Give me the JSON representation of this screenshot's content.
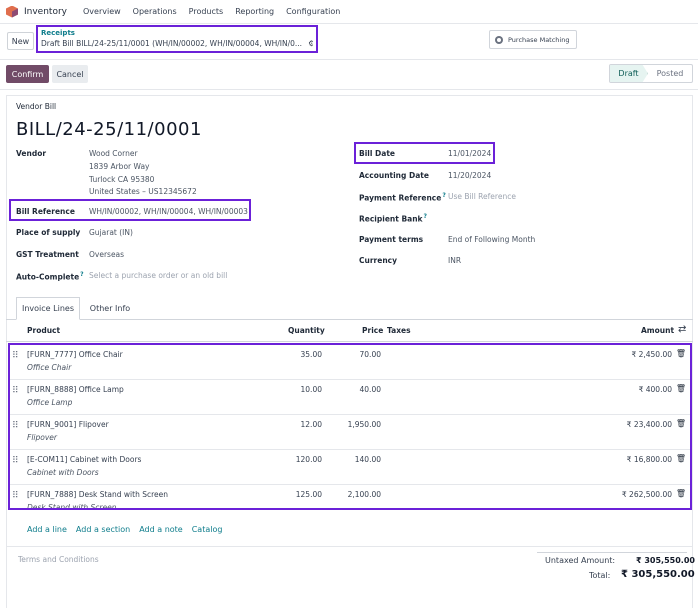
{
  "nav": {
    "app_name": "Inventory",
    "menu": [
      "Overview",
      "Operations",
      "Products",
      "Reporting",
      "Configuration"
    ]
  },
  "control": {
    "new_label": "New",
    "breadcrumb_parent": "Receipts",
    "breadcrumb_current": "Draft Bill BILL/24-25/11/0001 (WH/IN/00002, WH/IN/00004, WH/IN/0...",
    "purchase_matching_label": "Purchase Matching"
  },
  "actions": {
    "confirm_label": "Confirm",
    "cancel_label": "Cancel",
    "status_steps": [
      "Draft",
      "Posted"
    ],
    "active_status": "Draft"
  },
  "form": {
    "doc_type": "Vendor Bill",
    "title": "BILL/24-25/11/0001",
    "vendor_label": "Vendor",
    "vendor_lines": [
      "Wood Corner",
      "1839 Arbor Way",
      "Turlock CA 95380",
      "United States – US12345672"
    ],
    "bill_reference_label": "Bill Reference",
    "bill_reference_value": "WH/IN/00002, WH/IN/00004, WH/IN/00003",
    "place_of_supply_label": "Place of supply",
    "place_of_supply_value": "Gujarat (IN)",
    "gst_treatment_label": "GST Treatment",
    "gst_treatment_value": "Overseas",
    "auto_complete_label": "Auto-Complete",
    "auto_complete_placeholder": "Select a purchase order or an old bill",
    "bill_date_label": "Bill Date",
    "bill_date_value": "11/01/2024",
    "accounting_date_label": "Accounting Date",
    "accounting_date_value": "11/20/2024",
    "payment_reference_label": "Payment Reference",
    "payment_reference_placeholder": "Use Bill Reference",
    "recipient_bank_label": "Recipient Bank",
    "payment_terms_label": "Payment terms",
    "payment_terms_value": "End of Following Month",
    "currency_label": "Currency",
    "currency_value": "INR",
    "help_mark": "?"
  },
  "tabs": [
    "Invoice Lines",
    "Other Info"
  ],
  "table": {
    "headers": {
      "product": "Product",
      "quantity": "Quantity",
      "price": "Price",
      "taxes": "Taxes",
      "amount": "Amount"
    },
    "rows": [
      {
        "product": "[FURN_7777] Office Chair",
        "desc": "Office Chair",
        "qty": "35.00",
        "price": "70.00",
        "amount": "₹ 2,450.00"
      },
      {
        "product": "[FURN_8888] Office Lamp",
        "desc": "Office Lamp",
        "qty": "10.00",
        "price": "40.00",
        "amount": "₹ 400.00"
      },
      {
        "product": "[FURN_9001] Flipover",
        "desc": "Flipover",
        "qty": "12.00",
        "price": "1,950.00",
        "amount": "₹ 23,400.00"
      },
      {
        "product": "[E-COM11] Cabinet with Doors",
        "desc": "Cabinet with Doors",
        "qty": "120.00",
        "price": "140.00",
        "amount": "₹ 16,800.00"
      },
      {
        "product": "[FURN_7888] Desk Stand with Screen",
        "desc": "Desk Stand with Screen",
        "qty": "125.00",
        "price": "2,100.00",
        "amount": "₹ 262,500.00"
      }
    ]
  },
  "add_links": {
    "line": "Add a line",
    "section": "Add a section",
    "note": "Add a note",
    "catalog": "Catalog"
  },
  "terms_placeholder": "Terms and Conditions",
  "totals": {
    "untaxed_label": "Untaxed Amount:",
    "untaxed_value": "₹ 305,550.00",
    "total_label": "Total:",
    "total_value": "₹ 305,550.00"
  },
  "colors": {
    "brand": "#714b67",
    "link": "#0f7d8c",
    "highlight": "#6b21d8"
  }
}
